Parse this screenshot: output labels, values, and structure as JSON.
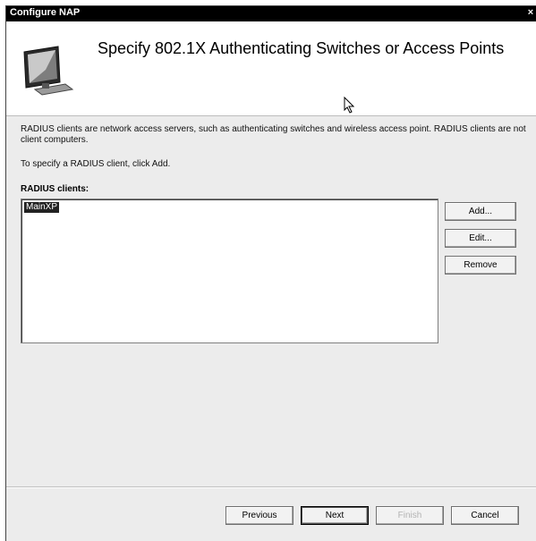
{
  "window": {
    "title": "Configure NAP",
    "close_label": "×"
  },
  "header": {
    "title": "Specify 802.1X Authenticating Switches or Access Points"
  },
  "description": {
    "line1": "RADIUS clients are network access servers, such as authenticating switches and wireless access point. RADIUS clients are not client computers.",
    "line2": "To specify a RADIUS client, click Add."
  },
  "radius_clients": {
    "label": "RADIUS clients:",
    "items": [
      {
        "name": "MainXP",
        "selected": true
      }
    ]
  },
  "side_buttons": {
    "add": "Add...",
    "edit": "Edit...",
    "remove": "Remove"
  },
  "footer_buttons": {
    "previous": "Previous",
    "next": "Next",
    "finish": "Finish",
    "cancel": "Cancel"
  },
  "icons": {
    "header": "computer-monitor-icon",
    "close": "close-icon",
    "cursor": "mouse-pointer-icon"
  },
  "colors": {
    "titlebar": "#000000",
    "dialog_bg": "#ececec",
    "selection": "#222222"
  }
}
